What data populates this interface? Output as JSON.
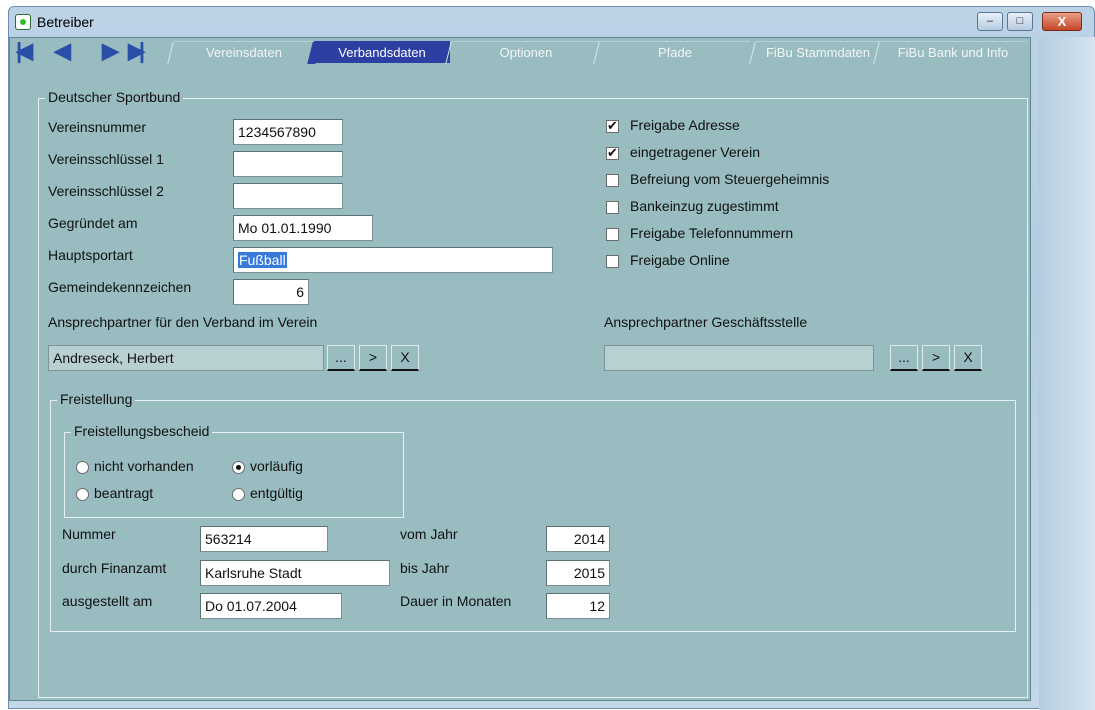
{
  "window": {
    "title": "Betreiber",
    "minimize": "–",
    "maximize": "□",
    "close": "X"
  },
  "nav": {
    "first": "|◀",
    "prev": "◀",
    "next": "▶",
    "last": "▶|"
  },
  "tabs": [
    {
      "label": "Vereinsdaten"
    },
    {
      "label": "Verbandsdaten"
    },
    {
      "label": "Optionen"
    },
    {
      "label": "Pfade"
    },
    {
      "label": "FiBu Stammdaten"
    },
    {
      "label": "FiBu Bank und Info"
    }
  ],
  "dsb": {
    "legend": "Deutscher Sportbund",
    "vereinsnummer": {
      "label": "Vereinsnummer",
      "value": "1234567890"
    },
    "schluessel1": {
      "label": "Vereinsschlüssel 1",
      "value": ""
    },
    "schluessel2": {
      "label": "Vereinsschlüssel 2",
      "value": ""
    },
    "gegruendet": {
      "label": "Gegründet am",
      "value": "Mo 01.01.1990"
    },
    "hauptsportart": {
      "label": "Hauptsportart",
      "value": "Fußball"
    },
    "gemeinde": {
      "label": "Gemeindekennzeichen",
      "value": "6"
    },
    "ansprech_verband": {
      "label": "Ansprechpartner für den Verband  im Verein",
      "value": "Andreseck, Herbert"
    },
    "ansprech_geschaeft": {
      "label": "Ansprechpartner  Geschäftsstelle",
      "value": ""
    },
    "btn_browse": "...",
    "btn_go": ">",
    "btn_clear": "X",
    "checks": [
      {
        "label": "Freigabe Adresse",
        "checked": true
      },
      {
        "label": "eingetragener Verein",
        "checked": true
      },
      {
        "label": "Befreiung vom Steuergeheimnis",
        "checked": false
      },
      {
        "label": "Bankeinzug zugestimmt",
        "checked": false
      },
      {
        "label": "Freigabe Telefonnummern",
        "checked": false
      },
      {
        "label": "Freigabe Online",
        "checked": false
      }
    ]
  },
  "freistellung": {
    "legend": "Freistellung",
    "bescheid": {
      "legend": "Freistellungsbescheid",
      "options": [
        {
          "label": "nicht vorhanden",
          "selected": false
        },
        {
          "label": "vorläufig",
          "selected": true
        },
        {
          "label": "beantragt",
          "selected": false
        },
        {
          "label": "entgültig",
          "selected": false
        }
      ]
    },
    "nummer": {
      "label": "Nummer",
      "value": "563214"
    },
    "finanzamt": {
      "label": "durch Finanzamt",
      "value": "Karlsruhe Stadt"
    },
    "ausgestellt": {
      "label": "ausgestellt am",
      "value": "Do 01.07.2004"
    },
    "vom_jahr": {
      "label": "vom Jahr",
      "value": "2014"
    },
    "bis_jahr": {
      "label": "bis Jahr",
      "value": "2015"
    },
    "dauer": {
      "label": "Dauer in Monaten",
      "value": "12"
    }
  }
}
